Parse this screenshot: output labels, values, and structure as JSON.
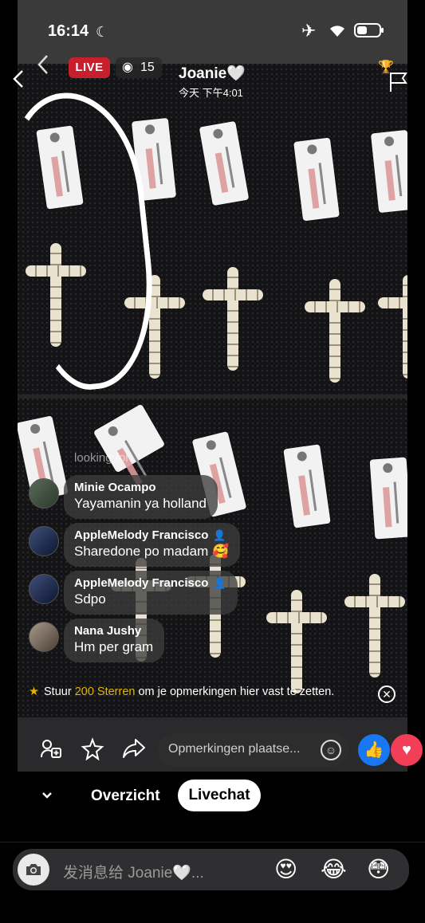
{
  "status_bar": {
    "time": "16:14",
    "moon_icon": "moon-icon",
    "airplane_icon": "airplane-icon",
    "wifi_icon": "wifi-icon",
    "battery_icon": "battery-icon"
  },
  "live_header": {
    "live_label": "LIVE",
    "viewer_count": "15",
    "host_name": "Joanie🤍",
    "timestamp": "今天 下午4:01"
  },
  "comments": {
    "faded_text": "looking for",
    "items": [
      {
        "name": "Minie Ocampo",
        "text": "Yayamanin ya  holland"
      },
      {
        "name": "AppleMelody Francisco",
        "text": "Sharedone po madam 🥰"
      },
      {
        "name": "AppleMelody Francisco",
        "text": "Sdpo"
      },
      {
        "name": "Nana Jushy",
        "text": "Hm per gram"
      }
    ]
  },
  "pin_hint": {
    "prefix": "Stuur ",
    "stars": "200 Sterren",
    "suffix": " om je opmerkingen hier vast te zetten."
  },
  "action_bar": {
    "comment_placeholder": "Opmerkingen plaatse..."
  },
  "tabs": {
    "overview": "Overzicht",
    "livechat": "Livechat"
  },
  "message_bar": {
    "placeholder": "发消息给 Joanie🤍...",
    "emoji_1": "😍",
    "emoji_2": "😂",
    "emoji_3": "😳"
  },
  "colors": {
    "live_red": "#c71f2b",
    "like_blue": "#1877f2",
    "love_pink": "#f33e58",
    "star_gold": "#e4b400"
  }
}
